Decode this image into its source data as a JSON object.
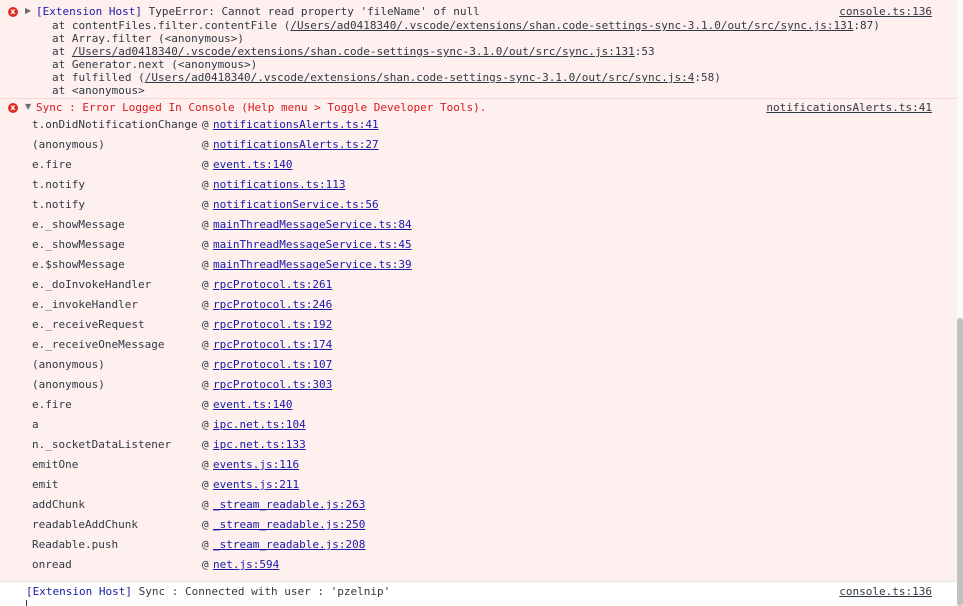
{
  "error1": {
    "host": "[Extension Host]",
    "message": " TypeError: Cannot read property 'fileName' of null",
    "source": "console.ts:136",
    "stack": [
      {
        "pre": "at contentFiles.filter.contentFile (",
        "link": "/Users/ad0418340/.vscode/extensions/shan.code-settings-sync-3.1.0/out/src/sync.js:131",
        "post": ":87)"
      },
      {
        "pre": "at Array.filter (<anonymous>)",
        "link": "",
        "post": ""
      },
      {
        "pre": "at ",
        "link": "/Users/ad0418340/.vscode/extensions/shan.code-settings-sync-3.1.0/out/src/sync.js:131",
        "post": ":53"
      },
      {
        "pre": "at Generator.next (<anonymous>)",
        "link": "",
        "post": ""
      },
      {
        "pre": "at fulfilled (",
        "link": "/Users/ad0418340/.vscode/extensions/shan.code-settings-sync-3.1.0/out/src/sync.js:4",
        "post": ":58)"
      },
      {
        "pre": "at <anonymous>",
        "link": "",
        "post": ""
      }
    ]
  },
  "error2": {
    "message": "Sync : Error Logged In Console (Help menu > Toggle Developer Tools).",
    "source": "notificationsAlerts.ts:41"
  },
  "trace": [
    {
      "fn": "t.onDidNotificationChange",
      "link": "notificationsAlerts.ts:41"
    },
    {
      "fn": "(anonymous)",
      "link": "notificationsAlerts.ts:27"
    },
    {
      "fn": "e.fire",
      "link": "event.ts:140"
    },
    {
      "fn": "t.notify",
      "link": "notifications.ts:113"
    },
    {
      "fn": "t.notify",
      "link": "notificationService.ts:56"
    },
    {
      "fn": "e._showMessage",
      "link": "mainThreadMessageService.ts:84"
    },
    {
      "fn": "e._showMessage",
      "link": "mainThreadMessageService.ts:45"
    },
    {
      "fn": "e.$showMessage",
      "link": "mainThreadMessageService.ts:39"
    },
    {
      "fn": "e._doInvokeHandler",
      "link": "rpcProtocol.ts:261"
    },
    {
      "fn": "e._invokeHandler",
      "link": "rpcProtocol.ts:246"
    },
    {
      "fn": "e._receiveRequest",
      "link": "rpcProtocol.ts:192"
    },
    {
      "fn": "e._receiveOneMessage",
      "link": "rpcProtocol.ts:174"
    },
    {
      "fn": "(anonymous)",
      "link": "rpcProtocol.ts:107"
    },
    {
      "fn": "(anonymous)",
      "link": "rpcProtocol.ts:303"
    },
    {
      "fn": "e.fire",
      "link": "event.ts:140"
    },
    {
      "fn": "a",
      "link": "ipc.net.ts:104"
    },
    {
      "fn": "n._socketDataListener",
      "link": "ipc.net.ts:133"
    },
    {
      "fn": "emitOne",
      "link": "events.js:116"
    },
    {
      "fn": "emit",
      "link": "events.js:211"
    },
    {
      "fn": "addChunk",
      "link": "_stream_readable.js:263"
    },
    {
      "fn": "readableAddChunk",
      "link": "_stream_readable.js:250"
    },
    {
      "fn": "Readable.push",
      "link": "_stream_readable.js:208"
    },
    {
      "fn": "onread",
      "link": "net.js:594"
    }
  ],
  "at_symbol": "@",
  "info": {
    "host": "[Extension Host]",
    "message": " Sync : Connected with user : 'pzelnip'",
    "source": "console.ts:136"
  },
  "icons": {
    "error": "x",
    "collapsed": "▶",
    "expanded": "▼"
  },
  "colors": {
    "error_bg": "#fff0f0",
    "error_text": "#d61b1b",
    "link": "#1a1aa6"
  }
}
